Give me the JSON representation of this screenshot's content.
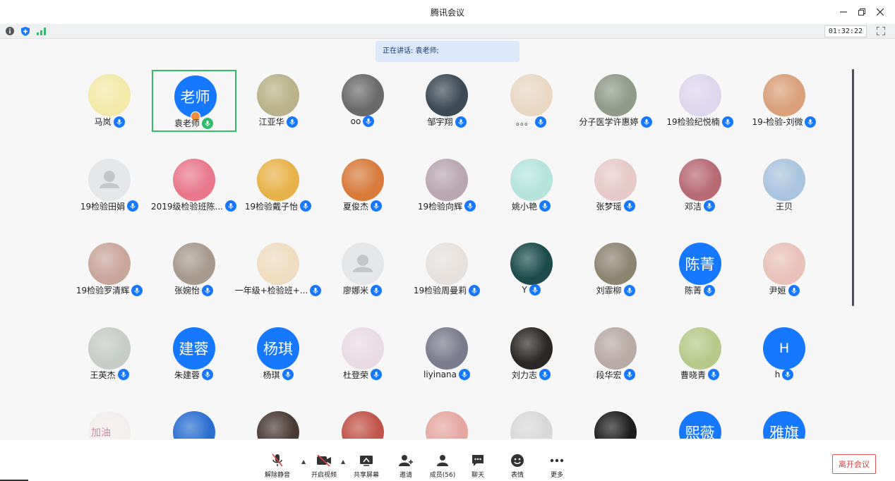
{
  "window": {
    "title": "腾讯会议"
  },
  "status": {
    "timer": "01:32:22"
  },
  "speaking": {
    "text": "正在讲话: 袁老师;"
  },
  "participants": [
    {
      "name": "马岚",
      "avatar": "pic",
      "color": "#f4e9a8"
    },
    {
      "name": "袁老师",
      "avatar": "text",
      "label": "老师",
      "speaking": true,
      "host": true
    },
    {
      "name": "江亚华",
      "avatar": "pic",
      "color": "#b9b28a"
    },
    {
      "name": "oo",
      "avatar": "pic",
      "color": "#6a6a6a"
    },
    {
      "name": "邹宇翔",
      "avatar": "pic",
      "color": "#3c4a55"
    },
    {
      "name": "。。。",
      "avatar": "pic",
      "color": "#e9d7c2"
    },
    {
      "name": "分子医学许惠婷",
      "avatar": "pic",
      "color": "#8f9a88"
    },
    {
      "name": "19检验纪悦楠",
      "avatar": "pic",
      "color": "#dcd6ee"
    },
    {
      "name": "19-检验-刘微",
      "avatar": "pic",
      "color": "#d9a07a"
    },
    {
      "name": "19检验田娟",
      "avatar": "default"
    },
    {
      "name": "2019级检验班陈...",
      "avatar": "pic",
      "color": "#e8788a"
    },
    {
      "name": "19检验戴子怡",
      "avatar": "pic",
      "color": "#e8b24a"
    },
    {
      "name": "夏俊杰",
      "avatar": "pic",
      "color": "#d77a3a"
    },
    {
      "name": "19检验向辉",
      "avatar": "pic",
      "color": "#b9a6b0"
    },
    {
      "name": "姚小艳",
      "avatar": "pic",
      "color": "#b6e3dc"
    },
    {
      "name": "张梦瑶",
      "avatar": "pic",
      "color": "#e7c9c9"
    },
    {
      "name": "邓洁",
      "avatar": "pic",
      "color": "#b86a73"
    },
    {
      "name": "王贝",
      "avatar": "pic",
      "color": "#a9c4de",
      "nomic": true
    },
    {
      "name": "19检验罗清辉",
      "avatar": "pic",
      "color": "#c9a69a"
    },
    {
      "name": "张婉怡",
      "avatar": "pic",
      "color": "#a79a8c"
    },
    {
      "name": "一年级+检验班+...",
      "avatar": "pic",
      "color": "#f0dcc0"
    },
    {
      "name": "廖娜米",
      "avatar": "default"
    },
    {
      "name": "19检验周曼莉",
      "avatar": "pic",
      "color": "#e6e1dd"
    },
    {
      "name": "Y",
      "avatar": "pic",
      "color": "#1c4a4a"
    },
    {
      "name": "刘霏柳",
      "avatar": "pic",
      "color": "#8d8470"
    },
    {
      "name": "陈菁",
      "avatar": "text",
      "label": "陈菁"
    },
    {
      "name": "尹姮",
      "avatar": "pic",
      "color": "#e8c2b8"
    },
    {
      "name": "王英杰",
      "avatar": "pic",
      "color": "#c6ccc6"
    },
    {
      "name": "朱建蓉",
      "avatar": "text",
      "label": "建蓉"
    },
    {
      "name": "杨琪",
      "avatar": "text",
      "label": "杨琪"
    },
    {
      "name": "杜登荣",
      "avatar": "pic",
      "color": "#e9dbe3"
    },
    {
      "name": "liyinana",
      "avatar": "pic",
      "color": "#7a7b8c"
    },
    {
      "name": "刘力志",
      "avatar": "pic",
      "color": "#2a2624"
    },
    {
      "name": "段华宏",
      "avatar": "pic",
      "color": "#b9aaa5"
    },
    {
      "name": "曹晓青",
      "avatar": "pic",
      "color": "#b7c98a"
    },
    {
      "name": "h",
      "avatar": "text",
      "label": "H",
      "latin": true
    },
    {
      "name": "",
      "avatar": "pic",
      "color": "#f3eeee",
      "nomic": true,
      "overlay": "加油"
    },
    {
      "name": "",
      "avatar": "pic",
      "color": "#2a6fd0",
      "nomic": true
    },
    {
      "name": "",
      "avatar": "pic",
      "color": "#4a3a34",
      "nomic": true
    },
    {
      "name": "",
      "avatar": "pic",
      "color": "#c0534a",
      "nomic": true
    },
    {
      "name": "",
      "avatar": "pic",
      "color": "#e5a7a0",
      "nomic": true
    },
    {
      "name": "",
      "avatar": "pic",
      "color": "#d8d8d8",
      "nomic": true
    },
    {
      "name": "",
      "avatar": "pic",
      "color": "#1d1d1d",
      "nomic": true
    },
    {
      "name": "",
      "avatar": "text",
      "label": "熙薇",
      "nomic": true
    },
    {
      "name": "",
      "avatar": "text",
      "label": "雅旗",
      "nomic": true
    }
  ],
  "toolbar": {
    "unmute": "解除静音",
    "video": "开启视频",
    "share": "共享屏幕",
    "invite": "邀请",
    "members": "成员(56)",
    "chat": "聊天",
    "emoji": "表情",
    "more": "更多",
    "leave": "离开会议"
  },
  "colors": {
    "accent": "#1677ff",
    "speaking": "#2fbd6a",
    "leave": "#e04040"
  }
}
